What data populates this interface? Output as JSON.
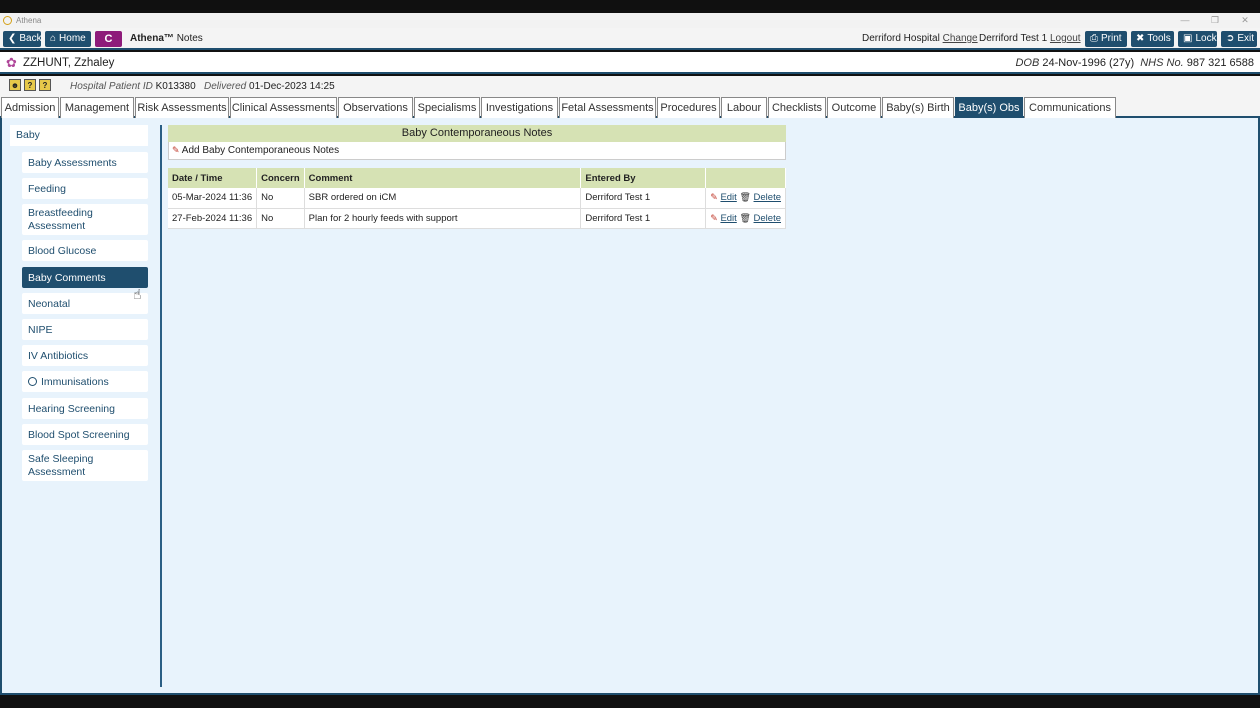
{
  "window": {
    "title": "Athena"
  },
  "toolbar": {
    "back_label": "Back",
    "home_label": "Home",
    "c_label": "C",
    "brand_name": "Athena™",
    "brand_module": "Notes",
    "hospital": "Derriford Hospital",
    "change_label": "Change",
    "user": "Derriford Test 1",
    "logout_label": "Logout",
    "print_label": "Print",
    "tools_label": "Tools",
    "lock_label": "Lock",
    "exit_label": "Exit"
  },
  "patient": {
    "name": "ZZHUNT, Zzhaley",
    "dob_label": "DOB",
    "dob_value": "24-Nov-1996 (27y)",
    "nhs_label": "NHS No.",
    "nhs_value": "987 321 6588",
    "hpid_label": "Hospital Patient ID",
    "hpid_value": "K013380",
    "delivered_label": "Delivered",
    "delivered_value": "01-Dec-2023 14:25"
  },
  "tabs": [
    "Admission",
    "Management",
    "Risk Assessments",
    "Clinical Assessments",
    "Observations",
    "Specialisms",
    "Investigations",
    "Fetal Assessments",
    "Procedures",
    "Labour",
    "Checklists",
    "Outcome",
    "Baby(s) Birth",
    "Baby(s) Obs",
    "Communications"
  ],
  "sidebar": {
    "header": "Baby",
    "items": [
      "Baby Assessments",
      "Feeding",
      "Breastfeeding Assessment",
      "Blood Glucose",
      "Baby Comments",
      "Neonatal",
      "NIPE",
      "IV Antibiotics",
      "Immunisations",
      "Hearing Screening",
      "Blood Spot Screening",
      "Safe Sleeping Assessment"
    ],
    "active": "Baby Comments"
  },
  "notes": {
    "title": "Baby Contemporaneous Notes",
    "add_label": "Add Baby Contemporaneous Notes",
    "columns": [
      "Date / Time",
      "Concern",
      "Comment",
      "Entered By"
    ],
    "edit_label": "Edit",
    "delete_label": "Delete",
    "rows": [
      {
        "datetime": "05-Mar-2024 11:36",
        "concern": "No",
        "comment": "SBR ordered on iCM",
        "entered_by": "Derriford Test 1"
      },
      {
        "datetime": "27-Feb-2024 11:36",
        "concern": "No",
        "comment": "Plan for 2 hourly feeds with support",
        "entered_by": "Derriford Test 1"
      }
    ]
  },
  "colors": {
    "primary": "#1f4e6e",
    "accent": "#8e1b7a",
    "panel_header": "#d6e2b4",
    "content_bg": "#e8f3fc"
  }
}
